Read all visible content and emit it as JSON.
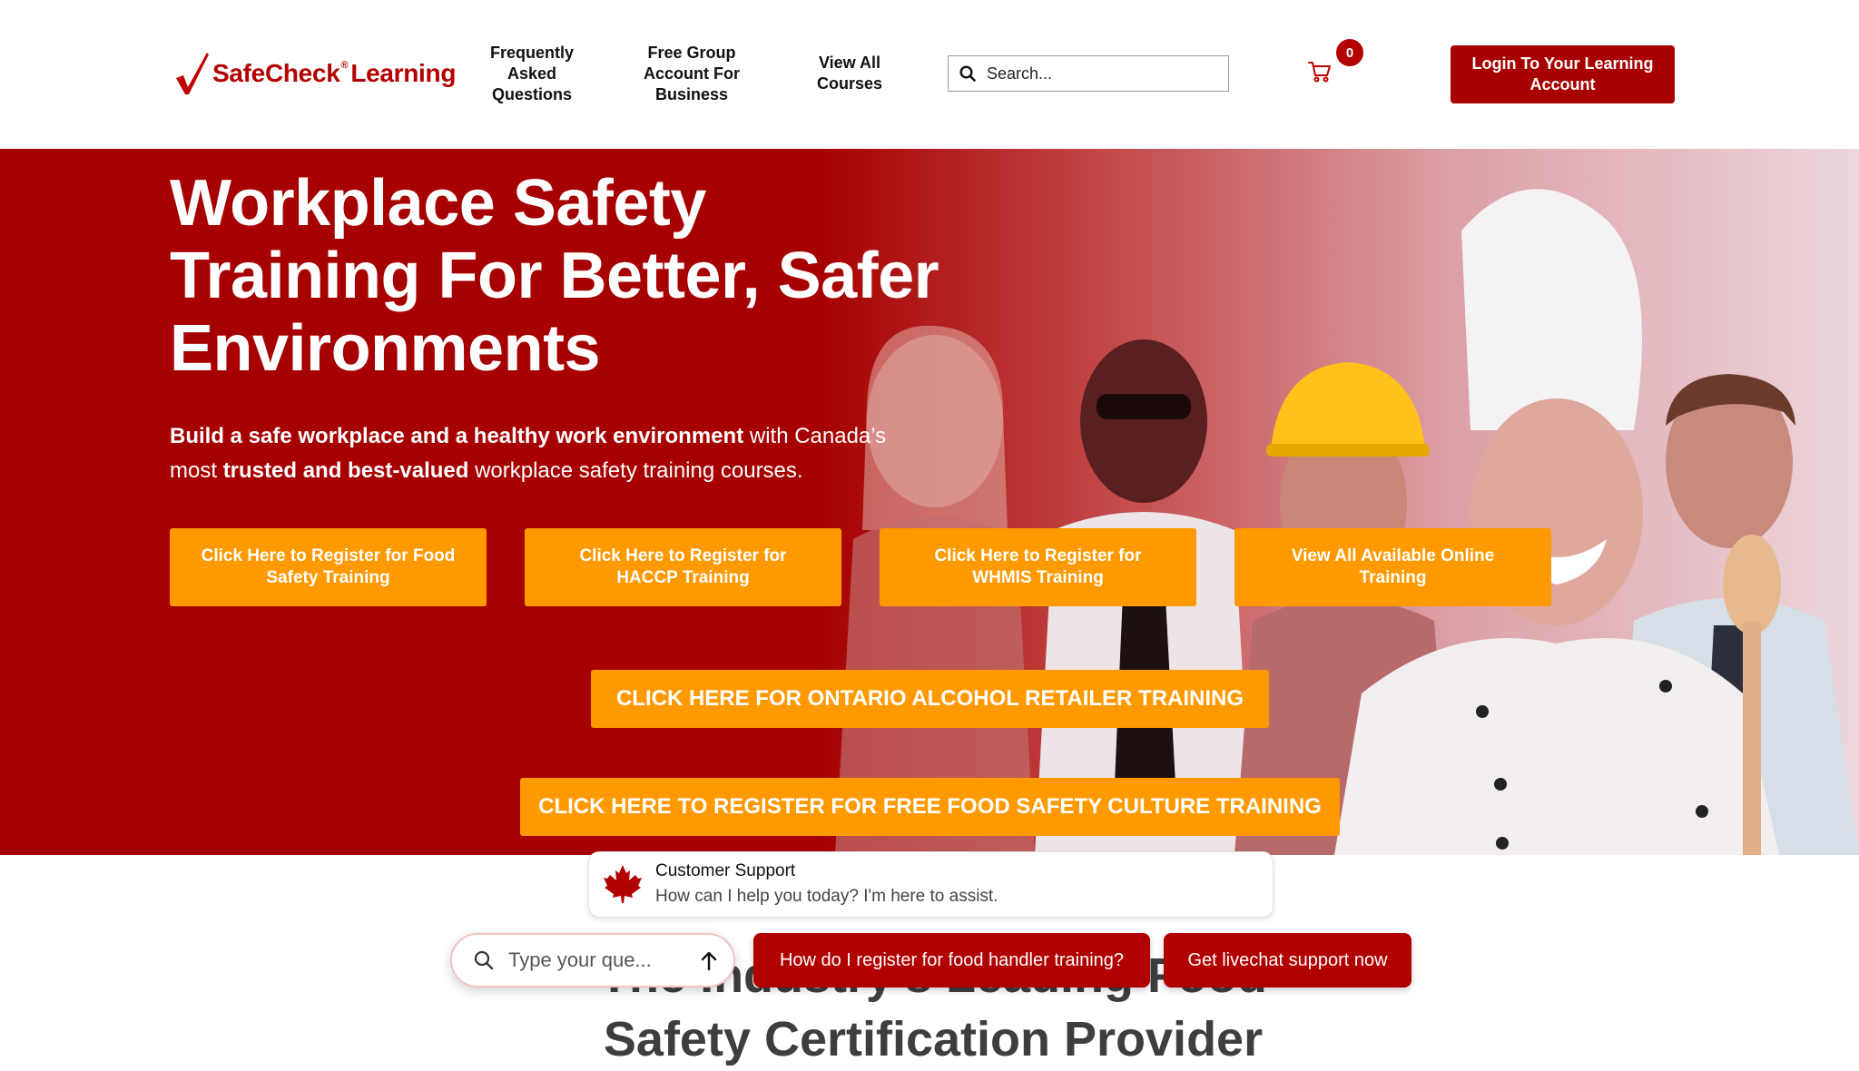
{
  "header": {
    "logo_text": "SafeCheck",
    "logo_reg": "®",
    "logo_text2": "Learning",
    "nav": {
      "faq": "Frequently Asked Questions",
      "group": "Free Group Account For Business",
      "courses": "View All Courses"
    },
    "search_placeholder": "Search...",
    "cart_count": "0",
    "login": "Login To Your Learning Account"
  },
  "hero": {
    "title": "Workplace Safety Training For Better, Safer Environments",
    "sub_bold1": "Build a safe workplace and a healthy work environment",
    "sub_text1": " with Canada’s most ",
    "sub_bold2": "trusted and best-valued",
    "sub_text2": " workplace safety training courses.",
    "buttons": [
      "Click Here to Register for Food Safety Training",
      "Click Here to Register for HACCP Training",
      "Click Here to Register for WHMIS Training",
      "View All Available Online Training"
    ],
    "alcohol_button": "CLICK HERE FOR ONTARIO ALCOHOL RETAILER TRAINING",
    "culture_button": "CLICK HERE TO REGISTER FOR FREE FOOD SAFETY CULTURE TRAINING"
  },
  "chat": {
    "title": "Customer Support",
    "message": "How can I help you today? I'm here to assist.",
    "input_placeholder": "Type your que...",
    "chip1": "How do I register for food handler training?",
    "chip2": "Get livechat support now"
  },
  "section_heading": "The Industry's Leading Food Safety Certification Provider",
  "colors": {
    "brand_red": "#a80000",
    "orange": "#ff9900"
  },
  "icons": [
    "checkmark-logo-icon",
    "search-icon",
    "cart-icon",
    "maple-leaf-icon",
    "arrow-up-icon"
  ]
}
